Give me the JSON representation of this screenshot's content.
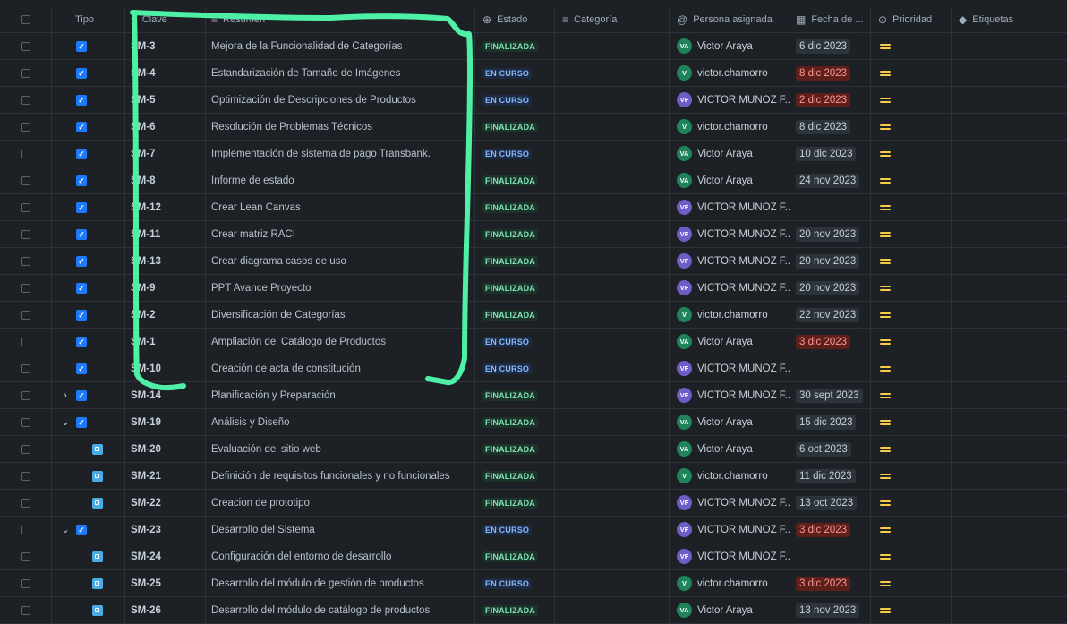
{
  "headers": {
    "tipo": "Tipo",
    "clave": "Clave",
    "resumen": "Resumen",
    "estado": "Estado",
    "categoria": "Categoría",
    "persona": "Persona asignada",
    "fecha": "Fecha de ...",
    "prioridad": "Prioridad",
    "etiquetas": "Etiquetas"
  },
  "icons": {
    "resumen": "lines-icon",
    "estado": "circle-arrow-icon",
    "categoria": "list-icon",
    "persona": "at-icon",
    "fecha": "calendar-icon",
    "prioridad": "chevron-circle-icon",
    "etiquetas": "tag-icon",
    "priority_medium": "priority-medium-icon"
  },
  "colors": {
    "finalizada_text": "#7ee2b8",
    "en_curso_text": "#85b8ff",
    "overdue_text": "#fd9891",
    "priority": "#f5cd47",
    "annotation": "#4ef0a6"
  },
  "rows": [
    {
      "kind": "task",
      "key": "SM-3",
      "summary": "Mejora de la Funcionalidad de Categorías",
      "status": "FINALIZADA",
      "sclass": "done",
      "initials": "VA",
      "assignee": "Victor Araya",
      "avcolor": "#1f845a",
      "date": "6 dic 2023",
      "overdue": false
    },
    {
      "kind": "task",
      "key": "SM-4",
      "summary": "Estandarización de Tamaño de Imágenes",
      "status": "EN CURSO",
      "sclass": "prog",
      "initials": "V",
      "assignee": "victor.chamorro",
      "avcolor": "#1f845a",
      "date": "8 dic 2023",
      "overdue": true
    },
    {
      "kind": "task",
      "key": "SM-5",
      "summary": "Optimización de Descripciones de Productos",
      "status": "EN CURSO",
      "sclass": "prog",
      "initials": "VF",
      "assignee": "VICTOR MUNOZ F...",
      "avcolor": "#6e5dc6",
      "date": "2 dic 2023",
      "overdue": true
    },
    {
      "kind": "task",
      "key": "SM-6",
      "summary": "Resolución de Problemas Técnicos",
      "status": "FINALIZADA",
      "sclass": "done",
      "initials": "V",
      "assignee": "victor.chamorro",
      "avcolor": "#1f845a",
      "date": "8 dic 2023",
      "overdue": false
    },
    {
      "kind": "task",
      "key": "SM-7",
      "summary": "Implementación de sistema de pago Transbank.",
      "status": "EN CURSO",
      "sclass": "prog",
      "initials": "VA",
      "assignee": "Victor Araya",
      "avcolor": "#1f845a",
      "date": "10 dic 2023",
      "overdue": false
    },
    {
      "kind": "task",
      "key": "SM-8",
      "summary": "Informe de estado",
      "status": "FINALIZADA",
      "sclass": "done",
      "initials": "VA",
      "assignee": "Victor Araya",
      "avcolor": "#1f845a",
      "date": "24 nov 2023",
      "overdue": false
    },
    {
      "kind": "task",
      "key": "SM-12",
      "summary": "Crear Lean Canvas",
      "status": "FINALIZADA",
      "sclass": "done",
      "initials": "VF",
      "assignee": "VICTOR MUNOZ F...",
      "avcolor": "#6e5dc6",
      "date": "",
      "overdue": false
    },
    {
      "kind": "task",
      "key": "SM-11",
      "summary": "Crear matriz RACI",
      "status": "FINALIZADA",
      "sclass": "done",
      "initials": "VF",
      "assignee": "VICTOR MUNOZ F...",
      "avcolor": "#6e5dc6",
      "date": "20 nov 2023",
      "overdue": false
    },
    {
      "kind": "task",
      "key": "SM-13",
      "summary": "Crear diagrama casos de uso",
      "status": "FINALIZADA",
      "sclass": "done",
      "initials": "VF",
      "assignee": "VICTOR MUNOZ F...",
      "avcolor": "#6e5dc6",
      "date": "20 nov 2023",
      "overdue": false
    },
    {
      "kind": "task",
      "key": "SM-9",
      "summary": "PPT Avance Proyecto",
      "status": "FINALIZADA",
      "sclass": "done",
      "initials": "VF",
      "assignee": "VICTOR MUNOZ F...",
      "avcolor": "#6e5dc6",
      "date": "20 nov 2023",
      "overdue": false
    },
    {
      "kind": "task",
      "key": "SM-2",
      "summary": "Diversificación de Categorías",
      "status": "FINALIZADA",
      "sclass": "done",
      "initials": "V",
      "assignee": "victor.chamorro",
      "avcolor": "#1f845a",
      "date": "22 nov 2023",
      "overdue": false
    },
    {
      "kind": "task",
      "key": "SM-1",
      "summary": "Ampliación del Catálogo de Productos",
      "status": "EN CURSO",
      "sclass": "prog",
      "initials": "VA",
      "assignee": "Victor Araya",
      "avcolor": "#1f845a",
      "date": "3 dic 2023",
      "overdue": true
    },
    {
      "kind": "task",
      "key": "SM-10",
      "summary": "Creación de acta de constitución",
      "status": "EN CURSO",
      "sclass": "prog",
      "initials": "VF",
      "assignee": "VICTOR MUNOZ F...",
      "avcolor": "#6e5dc6",
      "date": "",
      "overdue": false
    },
    {
      "kind": "parent",
      "chev": "›",
      "key": "SM-14",
      "summary": "Planificación y Preparación",
      "status": "FINALIZADA",
      "sclass": "done",
      "initials": "VF",
      "assignee": "VICTOR MUNOZ F...",
      "avcolor": "#6e5dc6",
      "date": "30 sept 2023",
      "overdue": false
    },
    {
      "kind": "parent",
      "chev": "⌄",
      "key": "SM-19",
      "summary": "Análisis y Diseño",
      "status": "FINALIZADA",
      "sclass": "done",
      "initials": "VA",
      "assignee": "Victor Araya",
      "avcolor": "#1f845a",
      "date": "15 dic 2023",
      "overdue": false
    },
    {
      "kind": "subtask",
      "key": "SM-20",
      "summary": "Evaluación del sitio web",
      "status": "FINALIZADA",
      "sclass": "done",
      "initials": "VA",
      "assignee": "Victor Araya",
      "avcolor": "#1f845a",
      "date": "6 oct 2023",
      "overdue": false
    },
    {
      "kind": "subtask",
      "key": "SM-21",
      "summary": "Definición de requisitos funcionales y no funcionales",
      "status": "FINALIZADA",
      "sclass": "done",
      "initials": "V",
      "assignee": "victor.chamorro",
      "avcolor": "#1f845a",
      "date": "11 dic 2023",
      "overdue": false
    },
    {
      "kind": "subtask",
      "key": "SM-22",
      "summary": "Creacion de prototipo",
      "status": "FINALIZADA",
      "sclass": "done",
      "initials": "VF",
      "assignee": "VICTOR MUNOZ F...",
      "avcolor": "#6e5dc6",
      "date": "13 oct 2023",
      "overdue": false
    },
    {
      "kind": "parent",
      "chev": "⌄",
      "key": "SM-23",
      "summary": "Desarrollo del Sistema",
      "status": "EN CURSO",
      "sclass": "prog",
      "initials": "VF",
      "assignee": "VICTOR MUNOZ F...",
      "avcolor": "#6e5dc6",
      "date": "3 dic 2023",
      "overdue": true
    },
    {
      "kind": "subtask",
      "key": "SM-24",
      "summary": "Configuración del entorno de desarrollo",
      "status": "FINALIZADA",
      "sclass": "done",
      "initials": "VF",
      "assignee": "VICTOR MUNOZ F...",
      "avcolor": "#6e5dc6",
      "date": "",
      "overdue": false
    },
    {
      "kind": "subtask",
      "key": "SM-25",
      "summary": "Desarrollo del módulo de gestión de productos",
      "status": "EN CURSO",
      "sclass": "prog",
      "initials": "V",
      "assignee": "victor.chamorro",
      "avcolor": "#1f845a",
      "date": "3 dic 2023",
      "overdue": true
    },
    {
      "kind": "subtask",
      "key": "SM-26",
      "summary": "Desarrollo del módulo de catálogo de productos",
      "status": "FINALIZADA",
      "sclass": "done",
      "initials": "VA",
      "assignee": "Victor Araya",
      "avcolor": "#1f845a",
      "date": "13 nov 2023",
      "overdue": false
    }
  ]
}
